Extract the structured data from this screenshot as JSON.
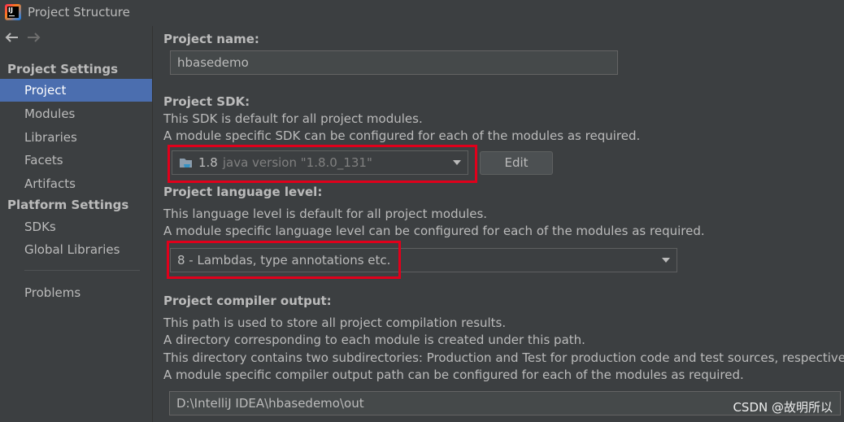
{
  "window": {
    "title": "Project Structure"
  },
  "sidebar": {
    "section_project_settings": "Project Settings",
    "project_items": [
      "Project",
      "Modules",
      "Libraries",
      "Facets",
      "Artifacts"
    ],
    "section_platform_settings": "Platform Settings",
    "platform_items": [
      "SDKs",
      "Global Libraries"
    ],
    "problems": "Problems",
    "selected": "Project"
  },
  "project": {
    "name_label": "Project name:",
    "name_value": "hbasedemo",
    "sdk_label": "Project SDK:",
    "sdk_desc_1": "This SDK is default for all project modules.",
    "sdk_desc_2": "A module specific SDK can be configured for each of the modules as required.",
    "sdk_name": "1.8",
    "sdk_version": "java version \"1.8.0_131\"",
    "edit_button": "Edit",
    "lang_label": "Project language level:",
    "lang_desc_1": "This language level is default for all project modules.",
    "lang_desc_2": "A module specific language level can be configured for each of the modules as required.",
    "lang_value": "8 - Lambdas, type annotations etc.",
    "output_label": "Project compiler output:",
    "output_desc_1": "This path is used to store all project compilation results.",
    "output_desc_2": "A directory corresponding to each module is created under this path.",
    "output_desc_3": "This directory contains two subdirectories: Production and Test for production code and test sources, respectively.",
    "output_desc_4": "A module specific compiler output path can be configured for each of the modules as required.",
    "output_path": "D:\\IntelliJ IDEA\\hbasedemo\\out"
  },
  "watermark": "CSDN @故明所以",
  "colors": {
    "background": "#3c3f41",
    "selection": "#4b6eaf",
    "highlight_box": "#e0001b",
    "text": "#bbbbbb"
  }
}
